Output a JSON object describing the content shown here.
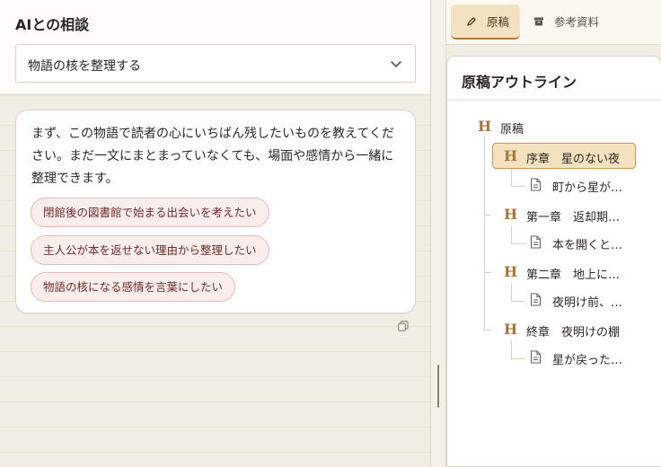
{
  "consult": {
    "title": "AIとの相談",
    "topic_selected": "物語の核を整理する",
    "message": "まず、この物語で読者の心にいちばん残したいものを教えてください。まだ一文にまとまっていなくても、場面や感情から一緒に整理できます。",
    "suggestions": [
      "閉館後の図書館で始まる出会いを考えたい",
      "主人公が本を返せない理由から整理したい",
      "物語の核になる感情を言葉にしたい"
    ]
  },
  "tabs": {
    "manuscript": "原稿",
    "reference": "参考資料"
  },
  "outline": {
    "title": "原稿アウトライン",
    "root": "原稿",
    "chapters": [
      {
        "title": "序章　星のない夜",
        "child": "町から星が…"
      },
      {
        "title": "第一章　返却期…",
        "child": "本を開くと…"
      },
      {
        "title": "第二章　地上に…",
        "child": "夜明け前、…"
      },
      {
        "title": "終章　夜明けの棚",
        "child": "星が戻った…"
      }
    ]
  },
  "colors": {
    "accent": "#a7753c",
    "chip_bg": "#faeeec",
    "selected_bg": "#f4e2bf"
  }
}
